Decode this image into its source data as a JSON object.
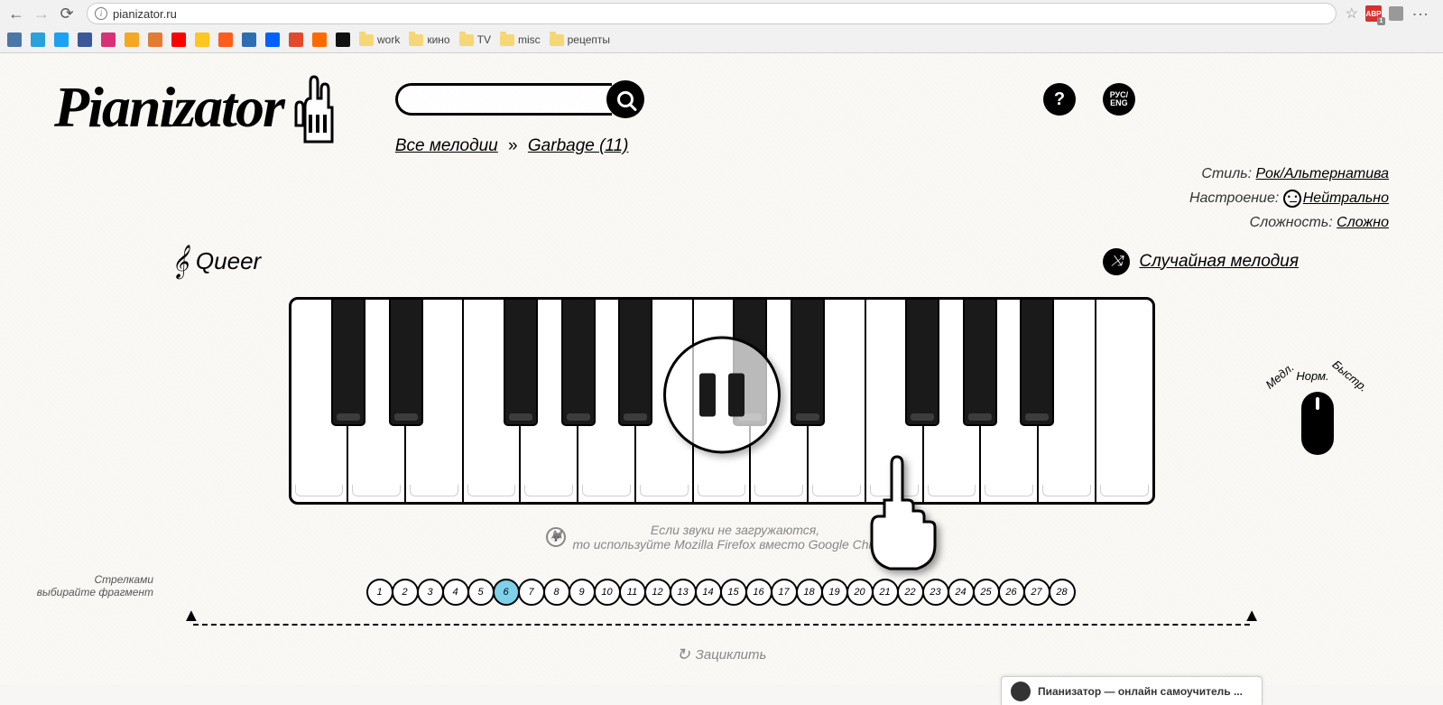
{
  "browser": {
    "url": "pianizator.ru",
    "bookmarks": [
      {
        "label": "",
        "color": "#4a76a8"
      },
      {
        "label": "",
        "color": "#2aa1da"
      },
      {
        "label": "",
        "color": "#1da1f2"
      },
      {
        "label": "",
        "color": "#3b5998"
      },
      {
        "label": "",
        "color": "#d93175"
      },
      {
        "label": "",
        "color": "#f5a623"
      },
      {
        "label": "",
        "color": "#e27c33"
      },
      {
        "label": "",
        "color": "#ff0000"
      },
      {
        "label": "",
        "color": "#ffc520"
      },
      {
        "label": "",
        "color": "#ff5c1f"
      },
      {
        "label": "",
        "color": "#2f6db3"
      },
      {
        "label": "",
        "color": "#0061ff"
      },
      {
        "label": "",
        "color": "#e2492f"
      },
      {
        "label": "",
        "color": "#ff6a00"
      },
      {
        "label": "",
        "color": "#111111"
      }
    ],
    "folders": [
      "work",
      "кино",
      "TV",
      "misc",
      "рецепты"
    ]
  },
  "logo_text": "Pianizator",
  "search_placeholder": "",
  "help_label": "?",
  "lang_label": "РУС/\nENG",
  "breadcrumb": {
    "all": "Все мелодии",
    "sep": "»",
    "artist": "Garbage (11)"
  },
  "meta": {
    "style_label": "Стиль:",
    "style_value": "Рок/Альтернатива",
    "mood_label": "Настроение:",
    "mood_value": "Нейтрально",
    "diff_label": "Сложность:",
    "diff_value": "Сложно"
  },
  "song_title": "Queer",
  "random_label": "Случайная мелодия",
  "tempo": {
    "slow": "Медл.",
    "normal": "Норм.",
    "fast": "Быстр."
  },
  "ff_hint_line1": "Если звуки не загружаются,",
  "ff_hint_line2": "то используйте Mozilla Firefox вместо Google Chrome",
  "fragments": {
    "hint": "Стрелками выбирайте фрагмент",
    "count": 28,
    "active": 6,
    "loop_label": "Зациклить"
  },
  "widget_title": "Пианизатор — онлайн самоучитель ..."
}
